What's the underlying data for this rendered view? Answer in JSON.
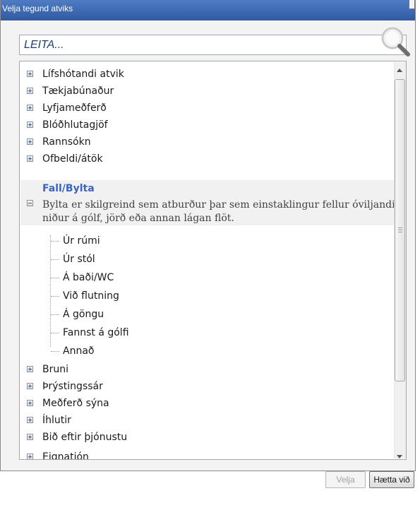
{
  "window": {
    "title": "Velja tegund atviks"
  },
  "search": {
    "placeholder": "LEITA..."
  },
  "tree": {
    "categories_top": [
      {
        "label": "Lífshótandi atvik"
      },
      {
        "label": "Tækjabúnaður"
      },
      {
        "label": "Lyfjameðferð"
      },
      {
        "label": "Blóðhlutagjöf"
      },
      {
        "label": "Rannsókn"
      },
      {
        "label": "Ofbeldi/átök"
      }
    ],
    "selected": {
      "label": "Fall/Bylta",
      "description": "Bylta er skilgreind sem atburður þar sem einstaklingur fellur óviljandi niður á gólf, jörð eða annan lágan flöt.",
      "children": [
        {
          "label": "Úr rúmi"
        },
        {
          "label": "Úr stól"
        },
        {
          "label": "Á baði/WC"
        },
        {
          "label": "Við flutning"
        },
        {
          "label": "Á göngu"
        },
        {
          "label": "Fannst á gólfi"
        },
        {
          "label": "Annað"
        }
      ]
    },
    "categories_bottom": [
      {
        "label": "Bruni"
      },
      {
        "label": "Þrýstingssár"
      },
      {
        "label": "Meðferð sýna"
      },
      {
        "label": "Íhlutir"
      },
      {
        "label": "Bið eftir þjónustu"
      },
      {
        "label": "Eignatjón"
      }
    ]
  },
  "buttons": {
    "select_label": "Velja",
    "cancel_label": "Hætta við"
  },
  "colors": {
    "titlebar": "#3c68b0",
    "selected_text": "#3b64c0",
    "search_text": "#1f3e78"
  }
}
